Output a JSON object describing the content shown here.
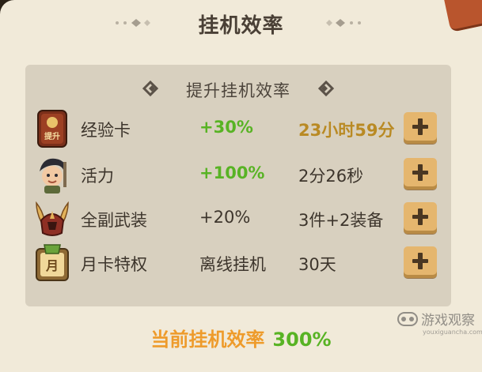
{
  "panel": {
    "title": "挂机效率",
    "subtitle": "提升挂机效率",
    "rows": [
      {
        "icon": "exp-card-icon",
        "name": "经验卡",
        "bonus": "+30%",
        "duration": "23小时59分",
        "icon_text": "提升"
      },
      {
        "icon": "vitality-hero-icon",
        "name": "活力",
        "bonus": "+100%",
        "duration": "2分26秒"
      },
      {
        "icon": "full-armor-helmet-icon",
        "name": "全副武装",
        "bonus": "+20%",
        "duration": "3件+2装备"
      },
      {
        "icon": "monthly-card-icon",
        "name": "月卡特权",
        "bonus": "离线挂机",
        "duration": "30天",
        "icon_text": "月"
      }
    ],
    "footer": {
      "label": "当前挂机效率",
      "value": "300%"
    }
  },
  "watermark": {
    "text": "游戏观察",
    "subtext": "youxiguancha.com"
  },
  "colors": {
    "bonus_green": "#58b324",
    "duration_gold": "#b98a24",
    "footer_orange": "#ee9b2b",
    "panel_bg": "#f1ead9",
    "inner_bg": "#d8d0bf"
  }
}
